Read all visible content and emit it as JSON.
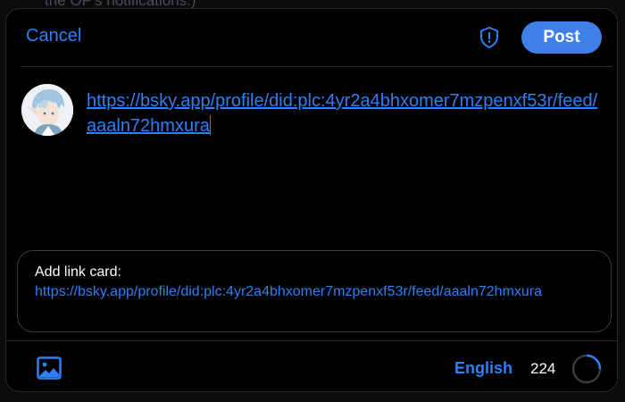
{
  "background": {
    "thread_text": "the OP's notifications.)"
  },
  "header": {
    "cancel_label": "Cancel",
    "post_label": "Post"
  },
  "composer": {
    "text": "https://bsky.app/profile/did:plc:4yr2a4bhxomer7mzpenxf53r/feed/aaaln72hmxura"
  },
  "link_card": {
    "label": "Add link card:",
    "url": "https://bsky.app/profile/did:plc:4yr2a4bhxomer7mzpenxf53r/feed/aaaln72hmxura"
  },
  "footer": {
    "language": "English",
    "remaining_count": "224",
    "character_progress_fraction": 0.25
  },
  "icons": {
    "shield": "shield-alert-icon",
    "image": "image-icon",
    "progress": "character-count-ring"
  },
  "colors": {
    "accent": "#2f7ff5",
    "post_button": "#3f7fe8",
    "background": "#000000",
    "border": "#2a2a2e"
  }
}
